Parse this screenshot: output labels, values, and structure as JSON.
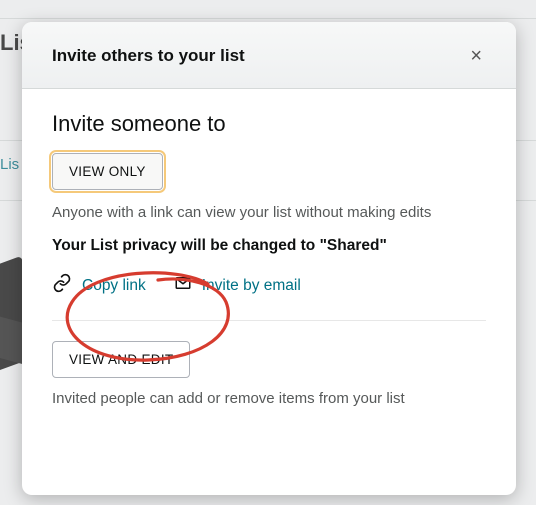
{
  "bg": {
    "frag1": "Lis",
    "frag2": "Lis"
  },
  "modal": {
    "title": "Invite others to your list",
    "close_glyph": "×",
    "heading": "Invite someone to",
    "view_only": {
      "label": "VIEW ONLY",
      "description": "Anyone with a link can view your list without making edits",
      "privacy_note": "Your List privacy will be changed to \"Shared\""
    },
    "actions": {
      "copy_link": "Copy link",
      "invite_email": "Invite by email"
    },
    "view_edit": {
      "label": "VIEW AND EDIT",
      "description": "Invited people can add or remove items from your list"
    }
  }
}
